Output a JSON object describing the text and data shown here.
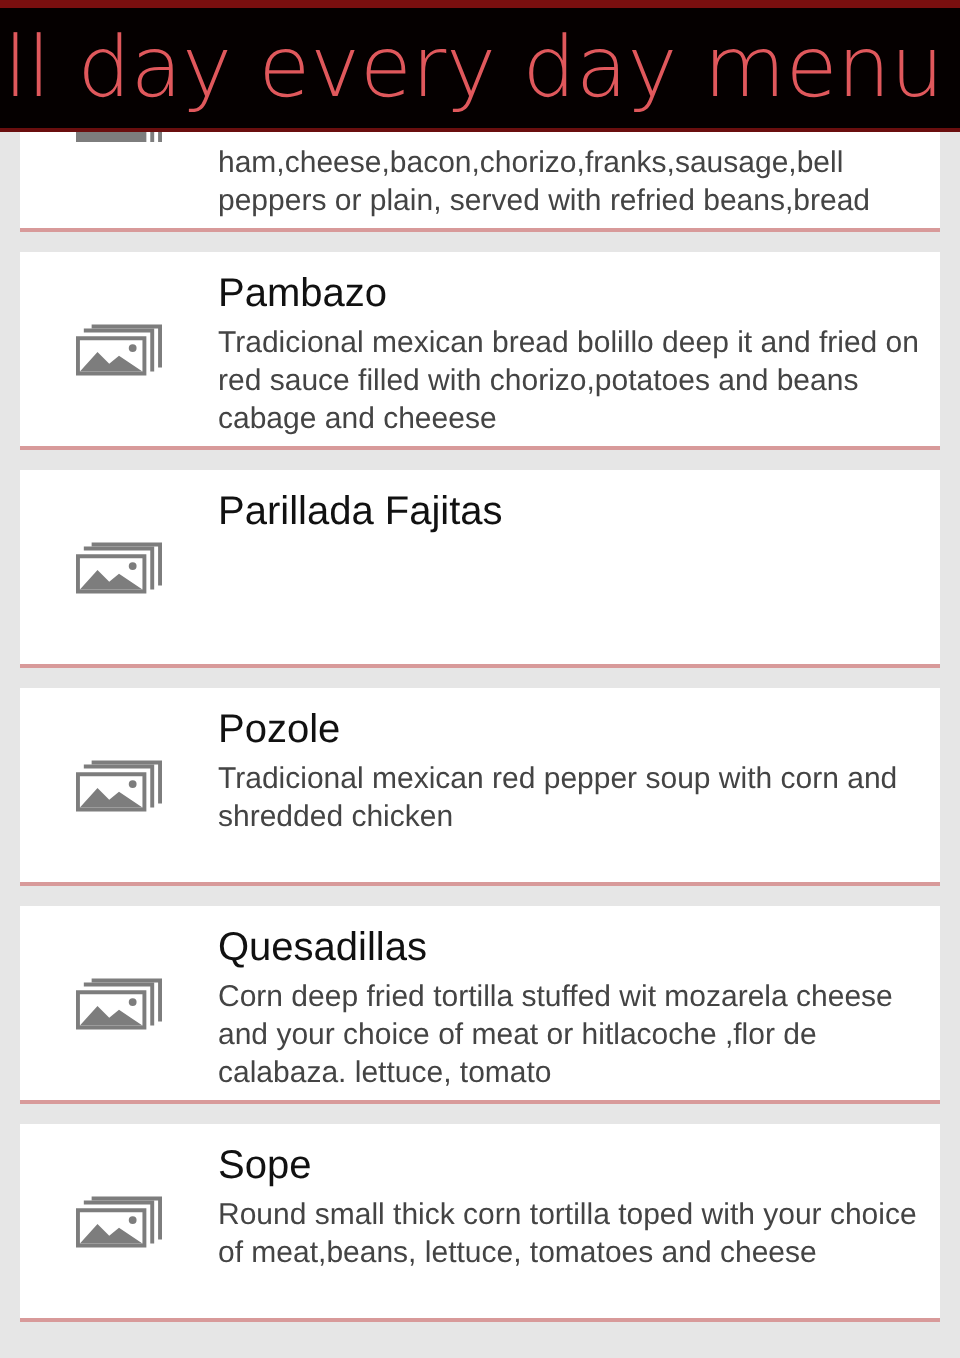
{
  "header": {
    "title": "ll day every day menu"
  },
  "items": [
    {
      "kind": "partial",
      "description": "ham,cheese,bacon,chorizo,franks,sausage,bell peppers or plain, served with refried  beans,bread"
    },
    {
      "kind": "full",
      "name": "Pambazo",
      "description": "Tradicional mexican bread bolillo deep it and fried on red sauce filled with chorizo,potatoes and beans  cabage and cheeese"
    },
    {
      "kind": "full",
      "name": "Parillada Fajitas"
    },
    {
      "kind": "full",
      "name": "Pozole",
      "description": "Tradicional mexican red pepper  soup  with corn and shredded chicken"
    },
    {
      "kind": "full",
      "name": "Quesadillas",
      "description": "Corn deep fried tortilla stuffed  wit mozarela cheese and  your choice of meat or hitlacoche ,flor de calabaza. lettuce, tomato"
    },
    {
      "kind": "full",
      "name": "Sope",
      "description": "Round small thick corn tortilla toped with your choice of meat,beans, lettuce, tomatoes and cheese"
    }
  ]
}
